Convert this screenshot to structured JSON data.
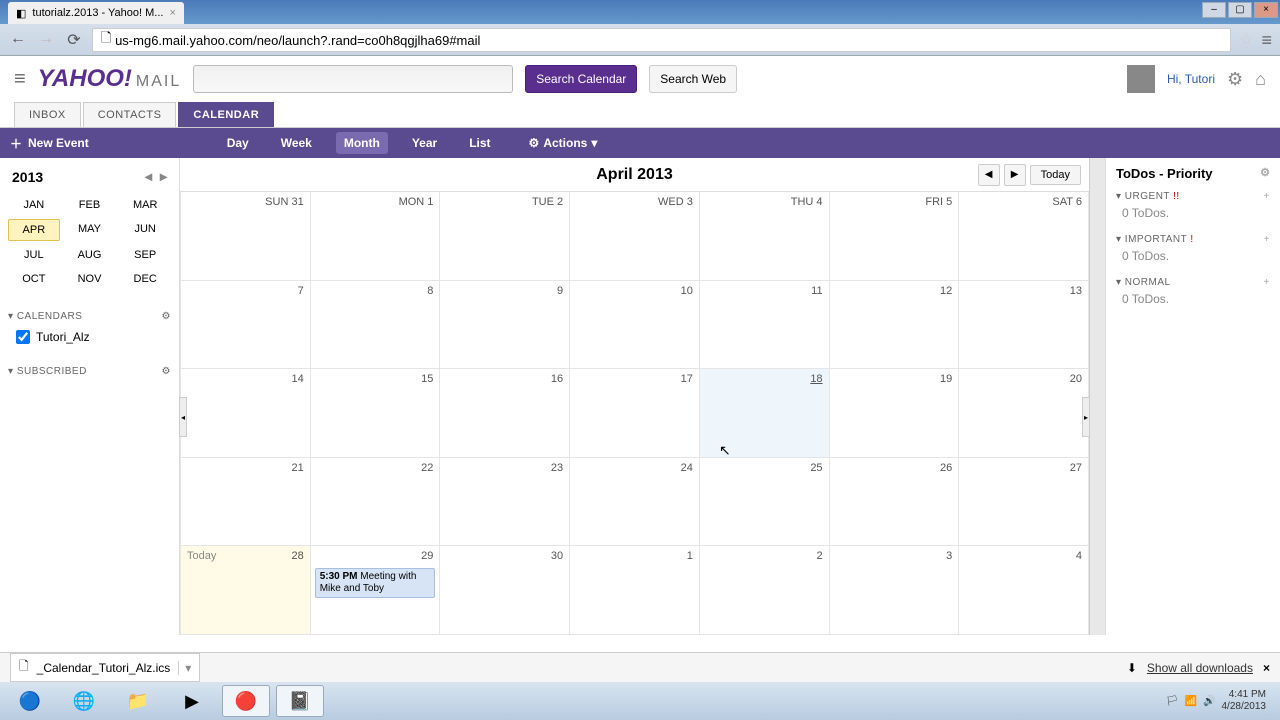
{
  "browser": {
    "tab_title": "tutorialz.2013 - Yahoo! M...",
    "url": "us-mg6.mail.yahoo.com/neo/launch?.rand=co0h8qgjlha69#mail"
  },
  "header": {
    "logo_main": "YAHOO!",
    "logo_sub": "MAIL",
    "search_cal": "Search Calendar",
    "search_web": "Search Web",
    "greeting": "Hi, Tutori"
  },
  "tabs": {
    "inbox": "INBOX",
    "contacts": "CONTACTS",
    "calendar": "CALENDAR"
  },
  "toolbar": {
    "new_event": "New Event",
    "views": {
      "day": "Day",
      "week": "Week",
      "month": "Month",
      "year": "Year",
      "list": "List"
    },
    "actions": "Actions"
  },
  "sidebar": {
    "year": "2013",
    "months": [
      "JAN",
      "FEB",
      "MAR",
      "APR",
      "MAY",
      "JUN",
      "JUL",
      "AUG",
      "SEP",
      "OCT",
      "NOV",
      "DEC"
    ],
    "selected_month": "APR",
    "calendars_head": "CALENDARS",
    "calendar_item": "Tutori_Alz",
    "subscribed_head": "SUBSCRIBED"
  },
  "calendar": {
    "title": "April 2013",
    "today_btn": "Today",
    "today_label": "Today",
    "weeks": [
      [
        {
          "dow": "SUN",
          "n": "31",
          "other": true
        },
        {
          "dow": "MON",
          "n": "1"
        },
        {
          "dow": "TUE",
          "n": "2"
        },
        {
          "dow": "WED",
          "n": "3"
        },
        {
          "dow": "THU",
          "n": "4"
        },
        {
          "dow": "FRI",
          "n": "5"
        },
        {
          "dow": "SAT",
          "n": "6"
        }
      ],
      [
        {
          "n": "7"
        },
        {
          "n": "8"
        },
        {
          "n": "9"
        },
        {
          "n": "10"
        },
        {
          "n": "11"
        },
        {
          "n": "12"
        },
        {
          "n": "13"
        }
      ],
      [
        {
          "n": "14"
        },
        {
          "n": "15"
        },
        {
          "n": "16"
        },
        {
          "n": "17"
        },
        {
          "n": "18",
          "highlight": true
        },
        {
          "n": "19"
        },
        {
          "n": "20"
        }
      ],
      [
        {
          "n": "21"
        },
        {
          "n": "22"
        },
        {
          "n": "23"
        },
        {
          "n": "24"
        },
        {
          "n": "25"
        },
        {
          "n": "26"
        },
        {
          "n": "27"
        }
      ],
      [
        {
          "n": "28",
          "today": true
        },
        {
          "n": "29",
          "event": {
            "time": "5:30 PM",
            "title": "Meeting with Mike and Toby"
          }
        },
        {
          "n": "30"
        },
        {
          "n": "1",
          "other": true
        },
        {
          "n": "2",
          "other": true
        },
        {
          "n": "3",
          "other": true
        },
        {
          "n": "4",
          "other": true
        }
      ]
    ]
  },
  "todos": {
    "head": "ToDos - Priority",
    "sections": [
      {
        "name": "URGENT",
        "mark": "!!",
        "empty": "0 ToDos."
      },
      {
        "name": "IMPORTANT",
        "mark": "!",
        "empty": "0 ToDos."
      },
      {
        "name": "NORMAL",
        "mark": "",
        "empty": "0 ToDos."
      }
    ]
  },
  "download": {
    "file": "_Calendar_Tutori_Alz.ics",
    "show_all": "Show all downloads"
  },
  "taskbar": {
    "time": "4:41 PM",
    "date": "4/28/2013"
  }
}
